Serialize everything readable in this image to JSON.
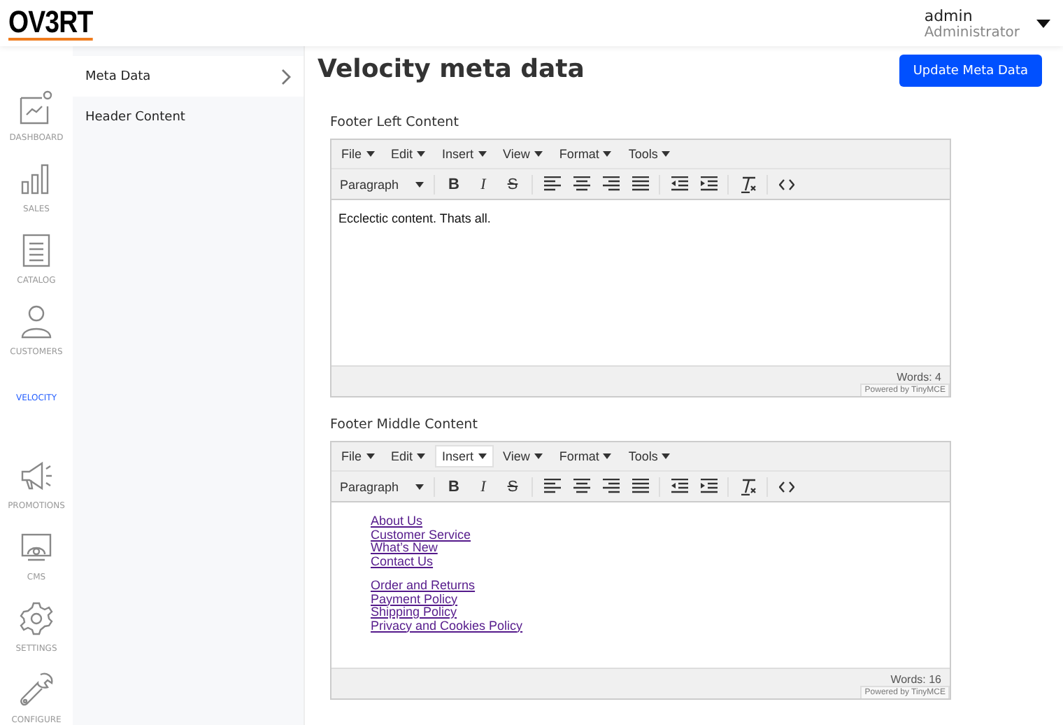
{
  "header": {
    "logo": "OV3RT",
    "user": {
      "name": "admin",
      "role": "Administrator"
    }
  },
  "nav": [
    {
      "label": "DASHBOARD",
      "selected": false
    },
    {
      "label": "SALES",
      "selected": false
    },
    {
      "label": "CATALOG",
      "selected": false
    },
    {
      "label": "CUSTOMERS",
      "selected": false
    },
    {
      "label": "VELOCITY",
      "selected": true
    },
    {
      "label": "PROMOTIONS",
      "selected": false
    },
    {
      "label": "CMS",
      "selected": false
    },
    {
      "label": "SETTINGS",
      "selected": false
    },
    {
      "label": "CONFIGURE",
      "selected": false
    }
  ],
  "submenu": [
    {
      "label": "Meta Data",
      "selected": true
    },
    {
      "label": "Header Content",
      "selected": false
    }
  ],
  "page": {
    "title": "Velocity meta data",
    "button": "Update Meta Data"
  },
  "editors": [
    {
      "label": "Footer Left Content",
      "menus": [
        {
          "label": "File",
          "selected": false
        },
        {
          "label": "Edit",
          "selected": false
        },
        {
          "label": "Insert",
          "selected": false
        },
        {
          "label": "View",
          "selected": false
        },
        {
          "label": "Format",
          "selected": false
        },
        {
          "label": "Tools",
          "selected": false
        }
      ],
      "block_format": "Paragraph",
      "glyphs": [
        "B",
        "I",
        "S"
      ],
      "kind": "text",
      "paragraphs": [
        "Ecclectic content. Thats all."
      ],
      "words": "Words: 4",
      "powered": "Powered by TinyMCE"
    },
    {
      "label": "Footer Middle Content",
      "menus": [
        {
          "label": "File",
          "selected": false
        },
        {
          "label": "Edit",
          "selected": false
        },
        {
          "label": "Insert",
          "selected": true
        },
        {
          "label": "View",
          "selected": false
        },
        {
          "label": "Format",
          "selected": false
        },
        {
          "label": "Tools",
          "selected": false
        }
      ],
      "block_format": "Paragraph",
      "glyphs": [
        "B",
        "I",
        "S"
      ],
      "kind": "links",
      "groups": [
        [
          "About Us",
          "Customer Service",
          "What’s New",
          "Contact Us"
        ],
        [
          "Order and Returns",
          "Payment Policy",
          "Shipping Policy",
          "Privacy and Cookies Policy"
        ]
      ],
      "words": "Words: 16",
      "powered": "Powered by TinyMCE"
    }
  ]
}
